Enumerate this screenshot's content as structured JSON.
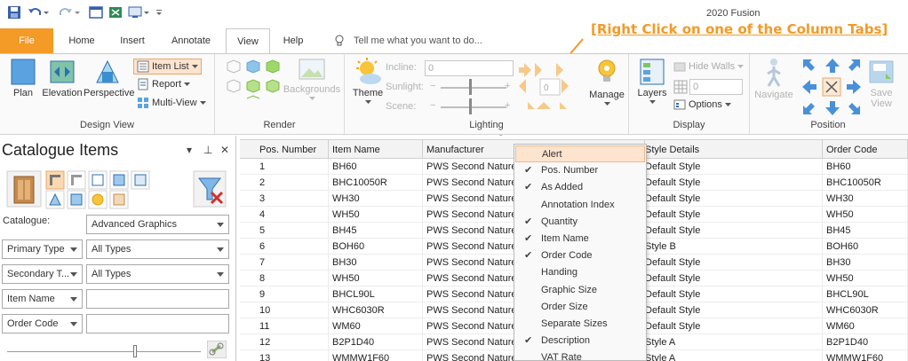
{
  "window": {
    "title": "2020 Fusion"
  },
  "callout": "[Right Click on one of the Column Tabs]",
  "tabs": [
    {
      "label": "File"
    },
    {
      "label": "Home"
    },
    {
      "label": "Insert"
    },
    {
      "label": "Annotate"
    },
    {
      "label": "View"
    },
    {
      "label": "Help"
    }
  ],
  "active_tab": "View",
  "tell_me": {
    "placeholder": "Tell me what you want to do..."
  },
  "ribbon": {
    "design_view": {
      "label": "Design View",
      "plan": "Plan",
      "elevation": "Elevation",
      "perspective": "Perspective",
      "item_list": "Item List",
      "report": "Report",
      "multi_view": "Multi-View"
    },
    "render": {
      "label": "Render",
      "backgrounds": "Backgrounds"
    },
    "lighting": {
      "label": "Lighting",
      "theme": "Theme",
      "incline": "Incline:",
      "sunlight": "Sunlight:",
      "scene": "Scene:",
      "incline_value": "0",
      "sun_value": "0",
      "manage": "Manage"
    },
    "display": {
      "label": "Display",
      "layers": "Layers",
      "hide_walls": "Hide Walls",
      "options": "Options",
      "wall_value": "0"
    },
    "position": {
      "label": "Position",
      "navigate": "Navigate",
      "save_view_1": "Save",
      "save_view_2": "View"
    }
  },
  "catalogue": {
    "title": "Catalogue Items",
    "catalogue_label": "Catalogue:",
    "catalogue_value": "Advanced Graphics",
    "filters": [
      {
        "field": "Primary Type",
        "value": "All Types"
      },
      {
        "field": "Secondary T...",
        "value": "All Types"
      },
      {
        "field": "Item Name",
        "value": ""
      },
      {
        "field": "Order Code",
        "value": ""
      }
    ]
  },
  "grid": {
    "columns": [
      "Pos. Number",
      "Item Name",
      "Manufacturer",
      "Style Details",
      "Order Code"
    ],
    "rows": [
      [
        "1",
        "BH60",
        "PWS Second Nature",
        "Default Style",
        "BH60"
      ],
      [
        "2",
        "BHC10050R",
        "PWS Second Nature",
        "Default Style",
        "BHC10050R"
      ],
      [
        "3",
        "WH30",
        "PWS Second Nature",
        "Default Style",
        "WH30"
      ],
      [
        "4",
        "WH50",
        "PWS Second Nature",
        "Default Style",
        "WH50"
      ],
      [
        "5",
        "BH45",
        "PWS Second Nature",
        "Default Style",
        "BH45"
      ],
      [
        "6",
        "BOH60",
        "PWS Second Nature",
        "Style B",
        "BOH60"
      ],
      [
        "7",
        "BH30",
        "PWS Second Nature",
        "Default Style",
        "BH30"
      ],
      [
        "8",
        "WH50",
        "PWS Second Nature",
        "Default Style",
        "WH50"
      ],
      [
        "9",
        "BHCL90L",
        "PWS Second Nature",
        "Default Style",
        "BHCL90L"
      ],
      [
        "10",
        "WHC6030R",
        "PWS Second Nature",
        "Default Style",
        "WHC6030R"
      ],
      [
        "11",
        "WM60",
        "PWS Second Nature",
        "Default Style",
        "WM60"
      ],
      [
        "12",
        "B2P1D40",
        "PWS Second Nature",
        "Style A",
        "B2P1D40"
      ],
      [
        "13",
        "WMMW1F60",
        "PWS Second Nature",
        "Style A",
        "WMMW1F60"
      ]
    ]
  },
  "context_menu": {
    "items": [
      {
        "label": "Alert",
        "checked": false
      },
      {
        "label": "Pos. Number",
        "checked": true
      },
      {
        "label": "As Added",
        "checked": true
      },
      {
        "label": "Annotation Index",
        "checked": false
      },
      {
        "label": "Quantity",
        "checked": true
      },
      {
        "label": "Item Name",
        "checked": true
      },
      {
        "label": "Order Code",
        "checked": true
      },
      {
        "label": "Handing",
        "checked": false
      },
      {
        "label": "Graphic Size",
        "checked": false
      },
      {
        "label": "Order Size",
        "checked": false
      },
      {
        "label": "Separate Sizes",
        "checked": false
      },
      {
        "label": "Description",
        "checked": true
      },
      {
        "label": "VAT Rate",
        "checked": false
      }
    ]
  },
  "colors": {
    "accent": "#f39a27",
    "menu_highlight": "#fce4cf",
    "ribbon_icon": "#4a90d9"
  }
}
